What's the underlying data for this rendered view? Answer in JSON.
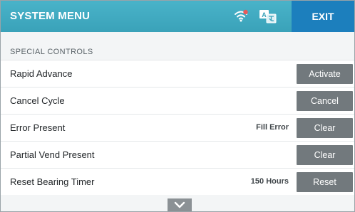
{
  "header": {
    "title": "SYSTEM MENU",
    "exit_label": "EXIT",
    "icons": [
      "wifi-off-icon",
      "language-icon"
    ],
    "bg_color": "#3aa2b9",
    "exit_color": "#1c7fbd"
  },
  "section": {
    "title": "SPECIAL CONTROLS"
  },
  "rows": [
    {
      "label": "Rapid Advance",
      "value": "",
      "button": "Activate"
    },
    {
      "label": "Cancel Cycle",
      "value": "",
      "button": "Cancel"
    },
    {
      "label": "Error Present",
      "value": "Fill Error",
      "button": "Clear"
    },
    {
      "label": "Partial Vend Present",
      "value": "",
      "button": "Clear"
    },
    {
      "label": "Reset Bearing Timer",
      "value": "150 Hours",
      "button": "Reset"
    }
  ],
  "scroll": {
    "icon": "chevron-down-icon"
  }
}
